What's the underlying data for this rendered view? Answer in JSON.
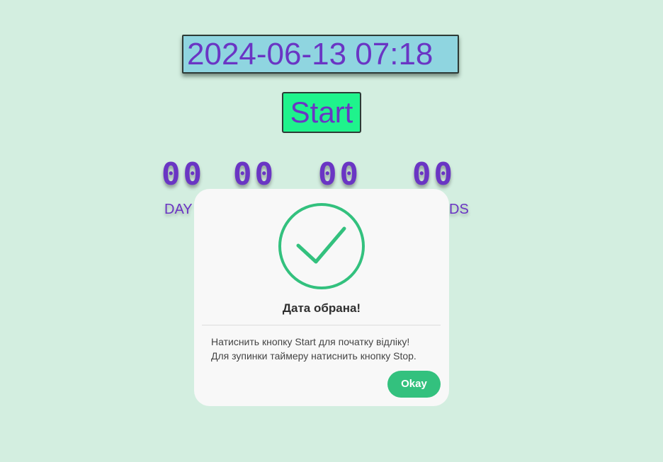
{
  "picker": {
    "value": "2024-06-13 07:18"
  },
  "controls": {
    "start_label": "Start"
  },
  "timer": {
    "days": "00",
    "hours": "00",
    "minutes": "00",
    "seconds": "00",
    "days_label": "DAY",
    "seconds_label_visible": "DS"
  },
  "modal": {
    "icon": "check-circle-icon",
    "title": "Дата обрана!",
    "line1": "Натиснить кнопку Start для початку відліку!",
    "line2": "Для зупинки таймеру натиснить кнопку Stop.",
    "ok_label": "Okay"
  },
  "colors": {
    "background": "#d3eee0",
    "accent_text": "#6a35c4",
    "start_button": "#1ff38c",
    "input_bg": "#8fd5e0",
    "success": "#33c17e"
  }
}
